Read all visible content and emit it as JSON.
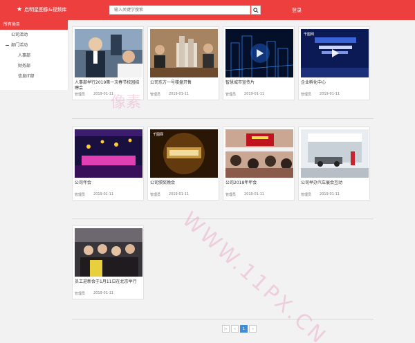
{
  "header": {
    "brand": "启明星图像&视频库",
    "search_placeholder": "输入关键字搜索",
    "login": "登录"
  },
  "sidebar": {
    "header": "所有类目",
    "items": [
      {
        "label": "公司活动"
      },
      {
        "label": "部门活动"
      },
      {
        "label": "人事部"
      },
      {
        "label": "财务部"
      },
      {
        "label": "信息IT部"
      }
    ]
  },
  "cards": [
    {
      "title": "人事部举行2019第一次春节校园招聘会",
      "author": "管理员",
      "date": "2019-01-11",
      "thumb": "recruit",
      "video": false
    },
    {
      "title": "公司东方一号楼盘开售",
      "author": "管理员",
      "date": "2019-01-11",
      "thumb": "property",
      "video": false
    },
    {
      "title": "智慧城市宣传片",
      "author": "管理员",
      "date": "2019-01-11",
      "thumb": "city",
      "video": true
    },
    {
      "title": "企业孵化中心",
      "author": "管理员",
      "date": "2019-01-11",
      "thumb": "incubator",
      "video": true
    },
    {
      "title": "公司年会",
      "author": "管理员",
      "date": "2019-01-11",
      "thumb": "annual",
      "video": false
    },
    {
      "title": "公司颁奖晚会",
      "author": "管理员",
      "date": "2019-01-11",
      "thumb": "award",
      "video": false
    },
    {
      "title": "公司2018年年会",
      "author": "管理员",
      "date": "2019-01-11",
      "thumb": "meeting2018",
      "video": false
    },
    {
      "title": "公司举办汽车展会互动",
      "author": "管理员",
      "date": "2019-01-11",
      "thumb": "autoshow",
      "video": false
    },
    {
      "title": "员工迎新会于1月11日在北京举行",
      "author": "管理员",
      "date": "2019-01-11",
      "thumb": "welcome",
      "video": false
    }
  ],
  "pagination": {
    "first": "|«",
    "prev": "«",
    "current": "1",
    "next": "»"
  },
  "watermark": {
    "line1": "WWW.11PX.CN",
    "line2": "像素"
  },
  "colors": {
    "accent": "#ee3f3f",
    "pager_active": "#3f8edb"
  }
}
